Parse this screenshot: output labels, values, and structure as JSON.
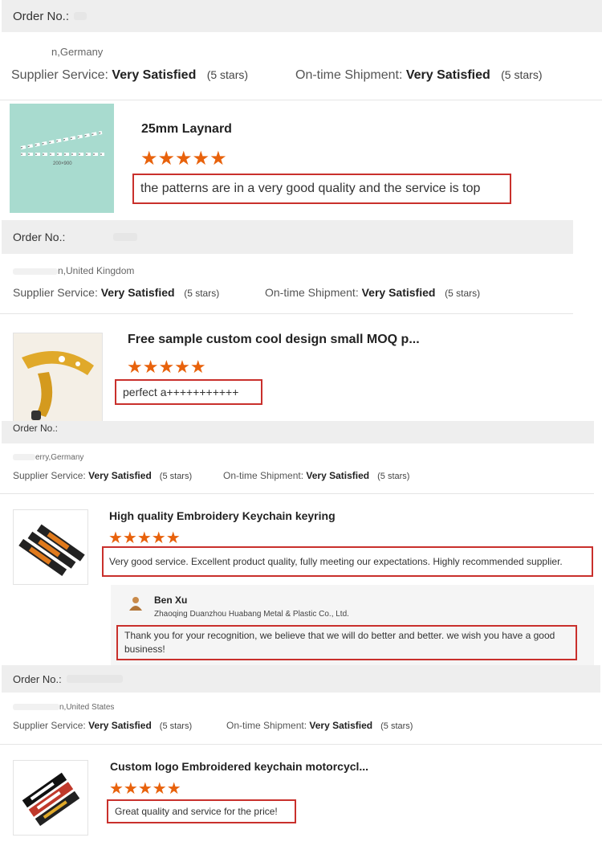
{
  "reviews": [
    {
      "order_label": "Order No.:",
      "country": "n,Germany",
      "supplier_label": "Supplier Service:",
      "supplier_value": "Very Satisfied",
      "supplier_stars": "(5 stars)",
      "shipment_label": "On-time Shipment:",
      "shipment_value": "Very Satisfied",
      "shipment_stars": "(5 stars)",
      "product_title": "25mm Laynard",
      "rating_stars": "★★★★★",
      "review_text": "the patterns are in a very good quality and the service is top",
      "thumb_caption": "200×900"
    },
    {
      "order_label": "Order No.:",
      "country": "n,United Kingdom",
      "supplier_label": "Supplier Service:",
      "supplier_value": "Very Satisfied",
      "supplier_stars": "(5 stars)",
      "shipment_label": "On-time Shipment:",
      "shipment_value": "Very Satisfied",
      "shipment_stars": "(5 stars)",
      "product_title": "Free sample custom cool design small MOQ p...",
      "rating_stars": "★★★★★",
      "review_text": "perfect a+++++++++++"
    },
    {
      "order_label": "Order No.:",
      "country": "erry,Germany",
      "supplier_label": "Supplier Service:",
      "supplier_value": "Very Satisfied",
      "supplier_stars": "(5 stars)",
      "shipment_label": "On-time Shipment:",
      "shipment_value": "Very Satisfied",
      "shipment_stars": "(5 stars)",
      "product_title": "High quality Embroidery Keychain keyring",
      "rating_stars": "★★★★★",
      "review_text": "Very good service. Excellent product quality, fully meeting our expectations. Highly recommended supplier.",
      "reply": {
        "name": "Ben Xu",
        "company": "Zhaoqing Duanzhou Huabang Metal & Plastic Co., Ltd.",
        "text_line1": "Thank you for your recognition, we believe that we will do better and better. we wish you have a good",
        "text_line2": "business!"
      }
    },
    {
      "order_label": "Order No.:",
      "country": "n,United States",
      "supplier_label": "Supplier Service:",
      "supplier_value": "Very Satisfied",
      "supplier_stars": "(5 stars)",
      "shipment_label": "On-time Shipment:",
      "shipment_value": "Very Satisfied",
      "shipment_stars": "(5 stars)",
      "product_title": "Custom logo Embroidered keychain motorcycl...",
      "rating_stars": "★★★★★",
      "review_text": "Great quality and service for the price!"
    }
  ],
  "colors": {
    "star": "#e8620c",
    "highlight_border": "#c9302c",
    "order_bar": "#eeeeee"
  }
}
